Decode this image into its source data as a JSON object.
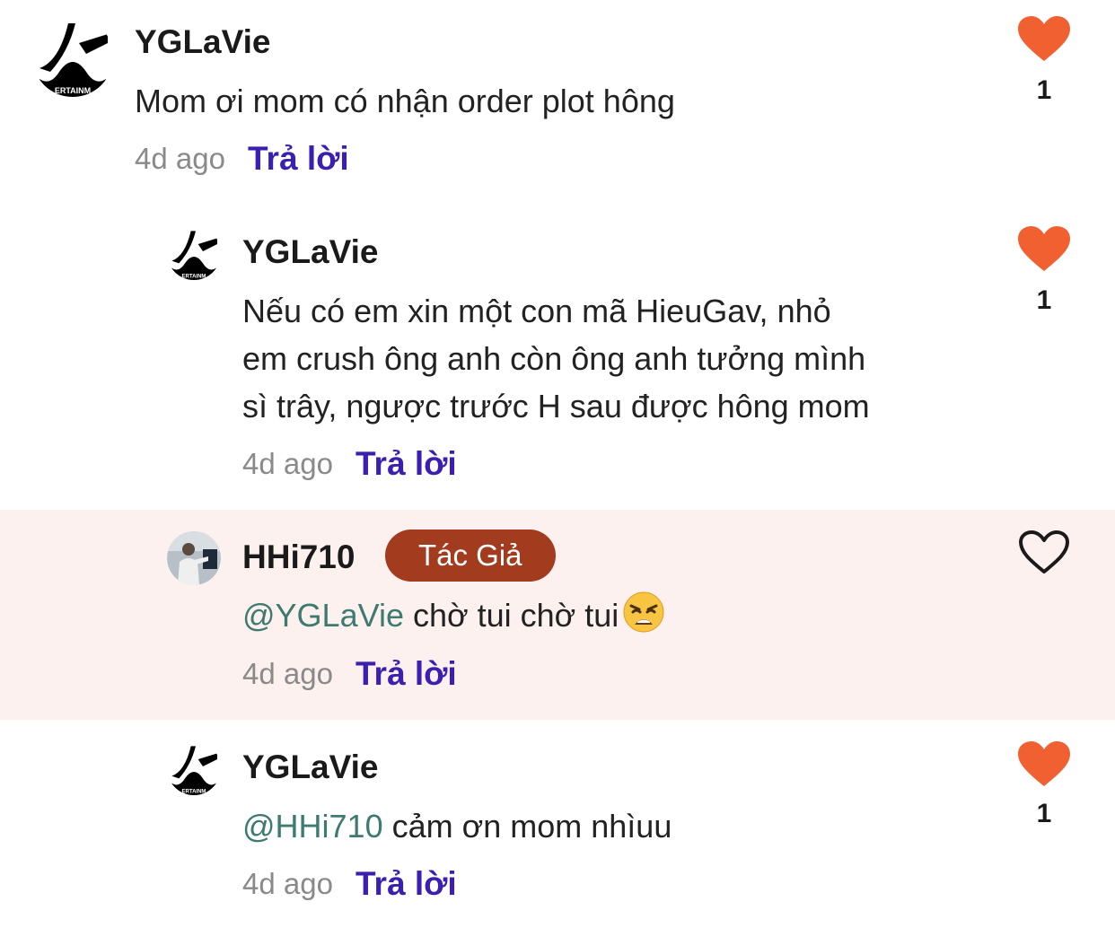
{
  "colors": {
    "heart_active": "#f06030",
    "reply_link": "#3a1fb0",
    "author_badge": "#a33c1f",
    "highlight_bg": "#fcf1ee",
    "mention": "#3d7a70"
  },
  "comments": [
    {
      "username": "YGLaVie",
      "text": "Mom ơi mom có nhận order plot hông",
      "time": "4d ago",
      "reply_label": "Trả lời",
      "likes": "1",
      "liked": true,
      "avatar_icon": "entertainment-logo-icon"
    },
    {
      "username": "YGLaVie",
      "text_lines": [
        "Nếu có em xin một con mã HieuGav, nhỏ",
        "em crush ông anh còn ông anh tưởng mình",
        "sì trây, ngược trước H sau được hông mom"
      ],
      "time": "4d ago",
      "reply_label": "Trả lời",
      "likes": "1",
      "liked": true,
      "avatar_icon": "entertainment-logo-icon"
    },
    {
      "username": "HHi710",
      "badge": "Tác Giả",
      "mention": "@YGLaVie",
      "text": " chờ tui chờ tui",
      "emoji": "weary-face-emoji",
      "time": "4d ago",
      "reply_label": "Trả lời",
      "liked": false,
      "avatar_icon": "user-photo-avatar"
    },
    {
      "username": "YGLaVie",
      "mention": "@HHi710",
      "text": " cảm ơn mom nhìuu",
      "time": "4d ago",
      "reply_label": "Trả lời",
      "likes": "1",
      "liked": true,
      "avatar_icon": "entertainment-logo-icon"
    }
  ]
}
